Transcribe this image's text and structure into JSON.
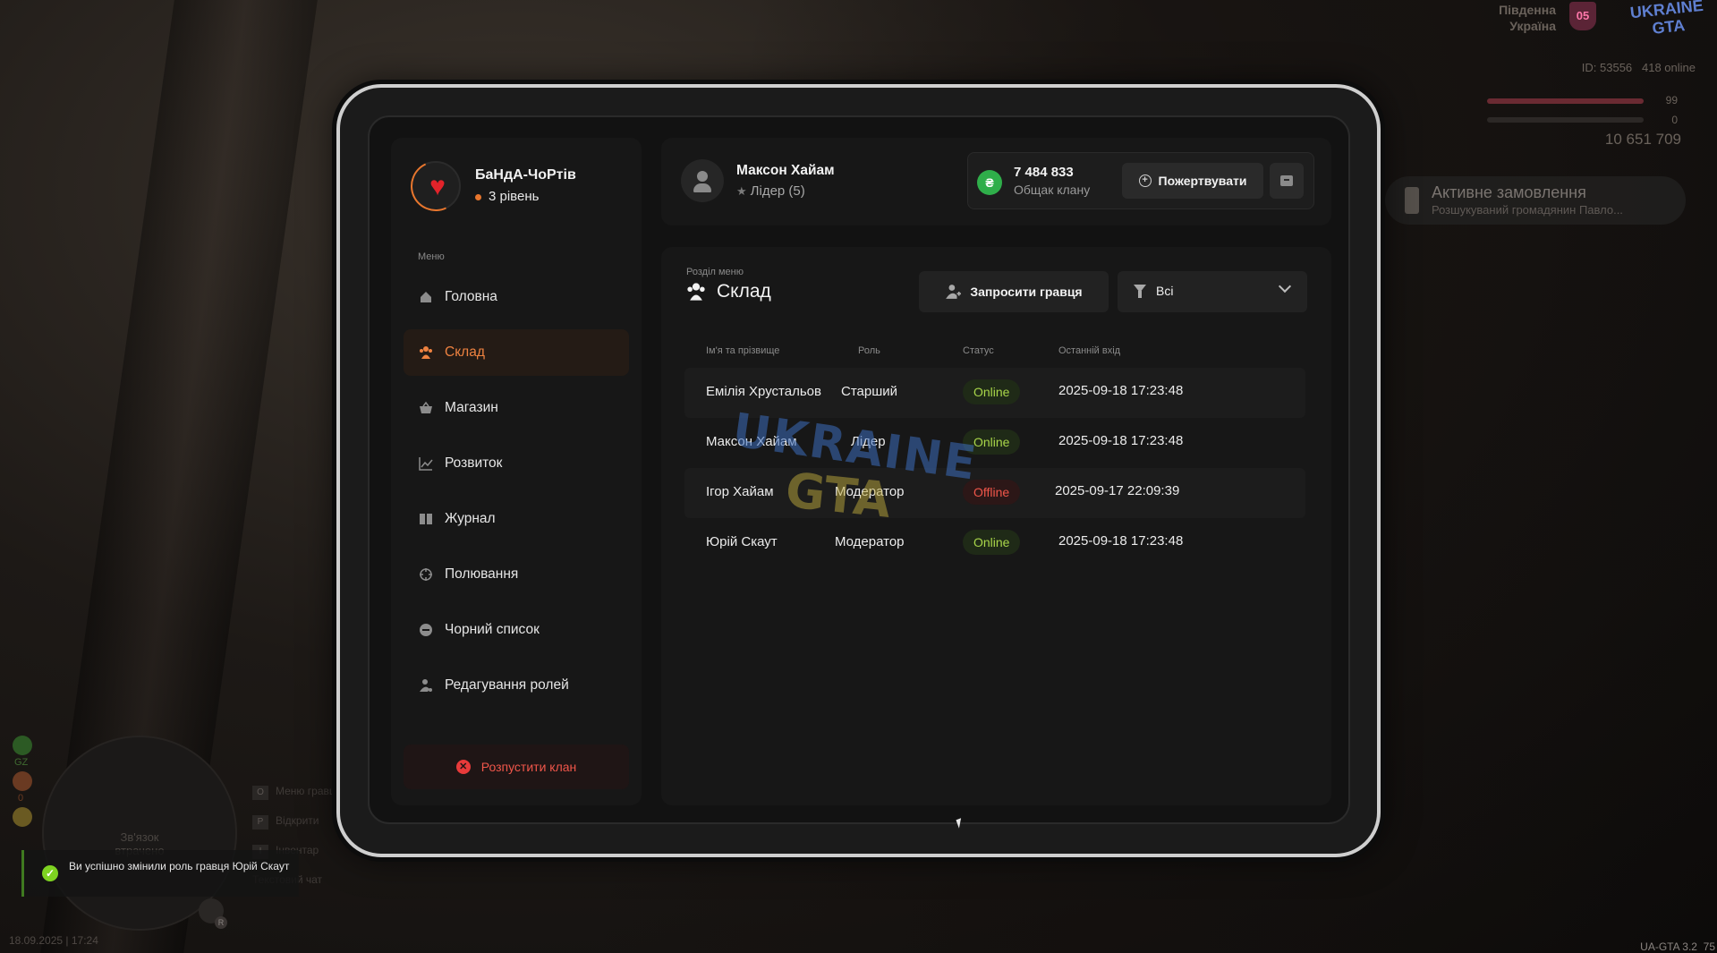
{
  "hud": {
    "region_line1": "Південна",
    "region_line2": "Україна",
    "region_badge": "05",
    "logo_text": "UKRAINE GTA",
    "player_id": "ID: 53556",
    "online": "418 online",
    "health": "99",
    "armor": "0",
    "money": "10 651 709",
    "order_title": "Активне замовлення",
    "order_subtitle": "Розшукуваний громадянин Павло...",
    "minimap_text_1": "Зв'язок",
    "minimap_text_2": "втрачено",
    "minimap_labels": [
      "GZ",
      "0"
    ],
    "keys": [
      {
        "key": "O",
        "label": "Меню гравця"
      },
      {
        "key": "P",
        "label": "Відкрити"
      },
      {
        "key": "I",
        "label": "Інвентар"
      },
      {
        "key": "",
        "label": "Текстовий чат"
      }
    ],
    "datetime": "18.09.2025 | 17:24",
    "version": "UA-GTA 3.2",
    "fps": "75",
    "mic_key": "R"
  },
  "toast": {
    "text": "Ви успішно змінили роль гравця Юрій Скаут",
    "color": "#7ed321"
  },
  "clan": {
    "name": "БаНдА-ЧоРтів",
    "level": "3 рівень",
    "menu_caption": "Меню",
    "nav": [
      {
        "label": "Головна",
        "icon": "home-icon"
      },
      {
        "label": "Склад",
        "icon": "members-icon",
        "active": true
      },
      {
        "label": "Магазин",
        "icon": "basket-icon"
      },
      {
        "label": "Розвиток",
        "icon": "chart-icon"
      },
      {
        "label": "Журнал",
        "icon": "book-icon"
      },
      {
        "label": "Полювання",
        "icon": "target-icon"
      },
      {
        "label": "Чорний список",
        "icon": "blocked-icon"
      },
      {
        "label": "Редагування ролей",
        "icon": "user-edit-icon"
      }
    ],
    "disband_label": "Розпустити клан",
    "accent": "#ee8240"
  },
  "header": {
    "user_name": "Максон Хайам",
    "user_role": "Лідер (5)",
    "bank_amount": "7 484 833",
    "bank_caption": "Общак клану",
    "donate_label": "Пожертвувати"
  },
  "main": {
    "section_caption": "Розділ меню",
    "section_title": "Склад",
    "invite_label": "Запросити гравця",
    "filter_value": "Всі",
    "columns": [
      "Ім'я та прізвище",
      "Роль",
      "Статус",
      "Останній вхід"
    ],
    "rows": [
      {
        "name": "Емілія Хрустальов",
        "role": "Старший",
        "status": "Online",
        "last": "2025-09-18 17:23:48"
      },
      {
        "name": "Максон Хайам",
        "role": "Лідер",
        "status": "Online",
        "last": "2025-09-18 17:23:48"
      },
      {
        "name": "Ігор Хайам",
        "role": "Модератор",
        "status": "Offline",
        "last": "2025-09-17 22:09:39"
      },
      {
        "name": "Юрій Скаут",
        "role": "Модератор",
        "status": "Online",
        "last": "2025-09-18 17:23:48"
      }
    ],
    "watermark_line1": "UKRAINE",
    "watermark_line2": "GTA"
  }
}
